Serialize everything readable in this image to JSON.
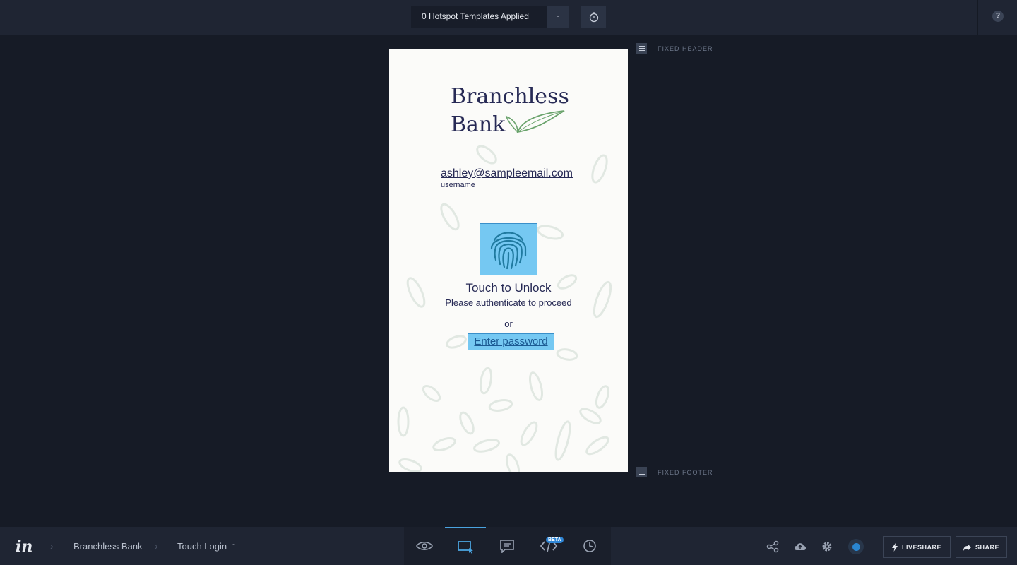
{
  "topbar": {
    "hotspot_templates": "0 Hotspot Templates Applied",
    "dropdown_caret": "-",
    "help": "?"
  },
  "canvas": {
    "fixed_header": "FIXED HEADER",
    "fixed_footer": "FIXED FOOTER"
  },
  "screen": {
    "logo_line1": "Branchless",
    "logo_line2": "Bank",
    "username_value": "ashley@sampleemail.com",
    "username_label": "username",
    "touch_title": "Touch to Unlock",
    "touch_sub": "Please authenticate to proceed",
    "or": "or",
    "password_link": "Enter password"
  },
  "bottombar": {
    "logo": "in",
    "project": "Branchless Bank",
    "screen_name": "Touch Login",
    "screen_caret": "-",
    "beta": "BETA",
    "liveshare": "LIVESHARE",
    "share": "SHARE"
  },
  "colors": {
    "accent": "#2f86d6",
    "hotspot": "#75c8f2",
    "brand_navy": "#272a55",
    "leaf_green": "#6aa36c"
  },
  "icons": [
    "timer-icon",
    "help-icon",
    "menu-icon",
    "fingerprint-icon",
    "preview-eye-icon",
    "build-hotspot-icon",
    "comment-icon",
    "inspect-code-icon",
    "history-clock-icon",
    "share-nodes-icon",
    "cloud-sync-icon",
    "gear-icon",
    "lightning-icon",
    "share-arrow-icon"
  ]
}
